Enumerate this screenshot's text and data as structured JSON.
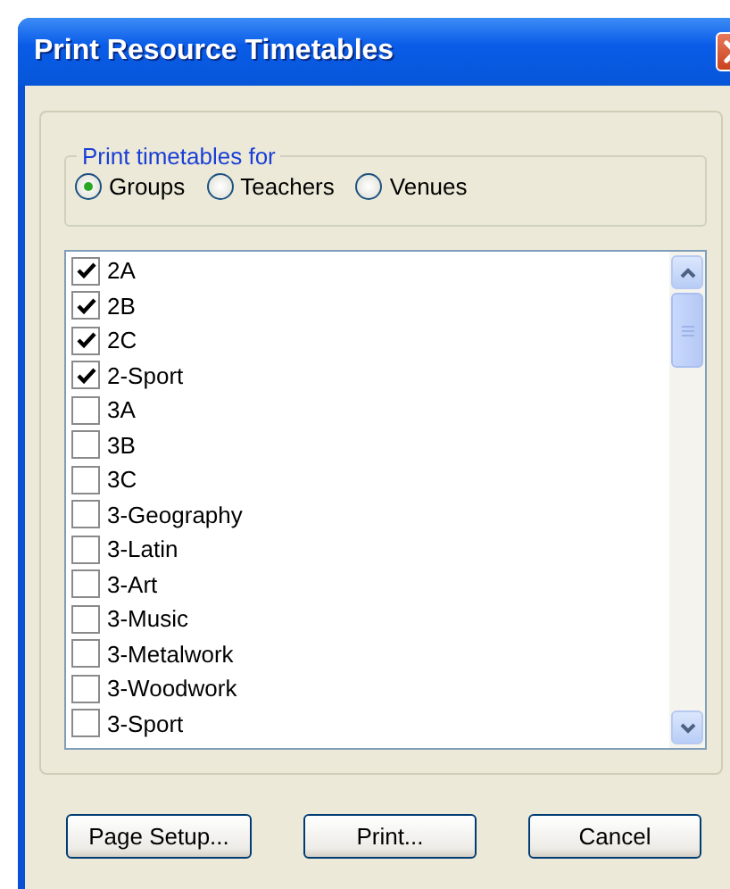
{
  "window": {
    "title": "Print Resource Timetables"
  },
  "print_for": {
    "legend": "Print timetables for",
    "options": [
      {
        "label": "Groups",
        "selected": true
      },
      {
        "label": "Teachers",
        "selected": false
      },
      {
        "label": "Venues",
        "selected": false
      }
    ]
  },
  "items": [
    {
      "label": "2A",
      "checked": true
    },
    {
      "label": "2B",
      "checked": true
    },
    {
      "label": "2C",
      "checked": true
    },
    {
      "label": "2-Sport",
      "checked": true
    },
    {
      "label": "3A",
      "checked": false
    },
    {
      "label": "3B",
      "checked": false
    },
    {
      "label": "3C",
      "checked": false
    },
    {
      "label": "3-Geography",
      "checked": false
    },
    {
      "label": "3-Latin",
      "checked": false
    },
    {
      "label": "3-Art",
      "checked": false
    },
    {
      "label": "3-Music",
      "checked": false
    },
    {
      "label": "3-Metalwork",
      "checked": false
    },
    {
      "label": "3-Woodwork",
      "checked": false
    },
    {
      "label": "3-Sport",
      "checked": false
    }
  ],
  "buttons": [
    "Page Setup...",
    "Print...",
    "Cancel"
  ]
}
